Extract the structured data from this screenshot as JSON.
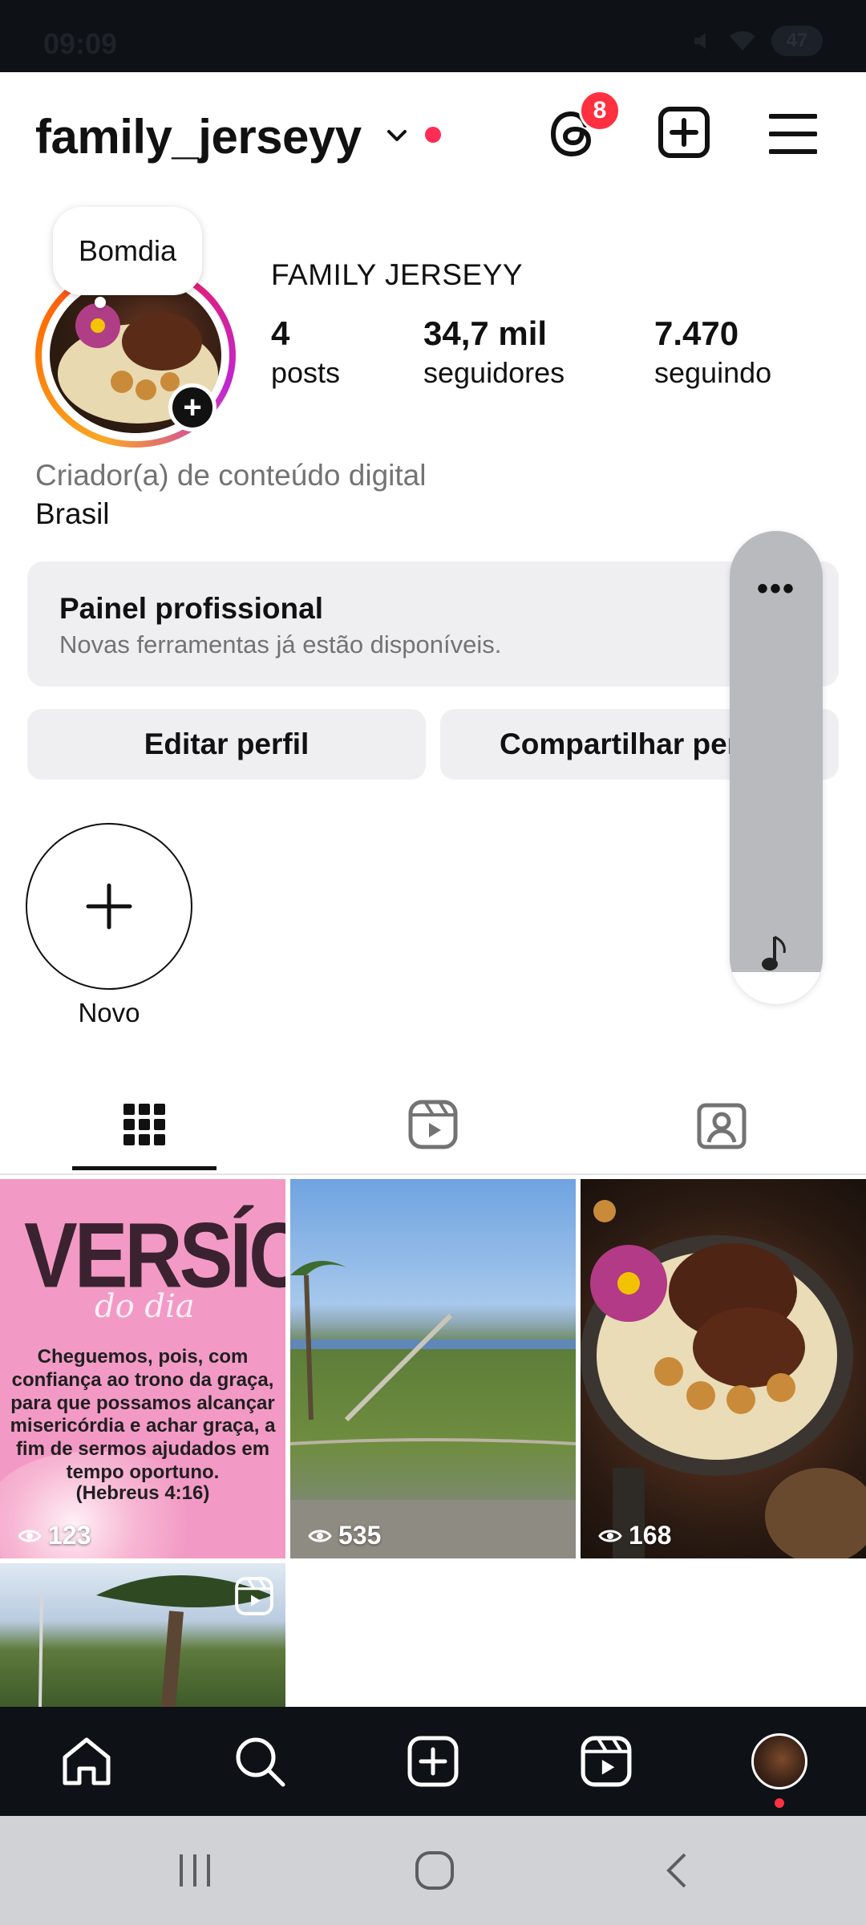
{
  "status_bar": {
    "time": "09:09",
    "battery": "47"
  },
  "header": {
    "username": "family_jerseyy",
    "threads_badge": "8"
  },
  "profile": {
    "note": "Bomdia",
    "full_name": "FAMILY JERSEYY",
    "stats": [
      {
        "value": "4",
        "label": "posts"
      },
      {
        "value": "34,7 mil",
        "label": "seguidores"
      },
      {
        "value": "7.470",
        "label": "seguindo"
      }
    ],
    "category": "Criador(a) de conteúdo digital",
    "location": "Brasil"
  },
  "pro_panel": {
    "title": "Painel profissional",
    "subtitle": "Novas ferramentas já estão disponíveis."
  },
  "buttons": {
    "edit": "Editar perfil",
    "share": "Compartilhar perfil"
  },
  "music_pill": {
    "menu": "•••"
  },
  "highlights": {
    "new_label": "Novo"
  },
  "tabs": [
    {
      "name": "grid",
      "icon": "grid-icon",
      "active": true
    },
    {
      "name": "reels",
      "icon": "reels-icon",
      "active": false
    },
    {
      "name": "tagged",
      "icon": "tagged-icon",
      "active": false
    }
  ],
  "posts": [
    {
      "views": "123",
      "title": "VERSÍCULO",
      "subtitle": "do dia",
      "verse": "Cheguemos, pois, com confiança ao trono da graça, para que possamos alcançar misericórdia e achar graça, a fim de sermos ajudados em tempo oportuno.",
      "reference": "(Hebreus 4:16)"
    },
    {
      "views": "535"
    },
    {
      "views": "168"
    },
    {
      "views": ""
    }
  ],
  "bottom_nav": [
    {
      "name": "home",
      "icon": "home-icon"
    },
    {
      "name": "search",
      "icon": "search-icon"
    },
    {
      "name": "create",
      "icon": "add-post-icon"
    },
    {
      "name": "reels",
      "icon": "reels-icon"
    },
    {
      "name": "profile",
      "icon": "profile-avatar"
    }
  ],
  "colors": {
    "accent_red": "#ff3040",
    "panel_bg": "#efeff2",
    "nav_bg": "#0e1116"
  }
}
